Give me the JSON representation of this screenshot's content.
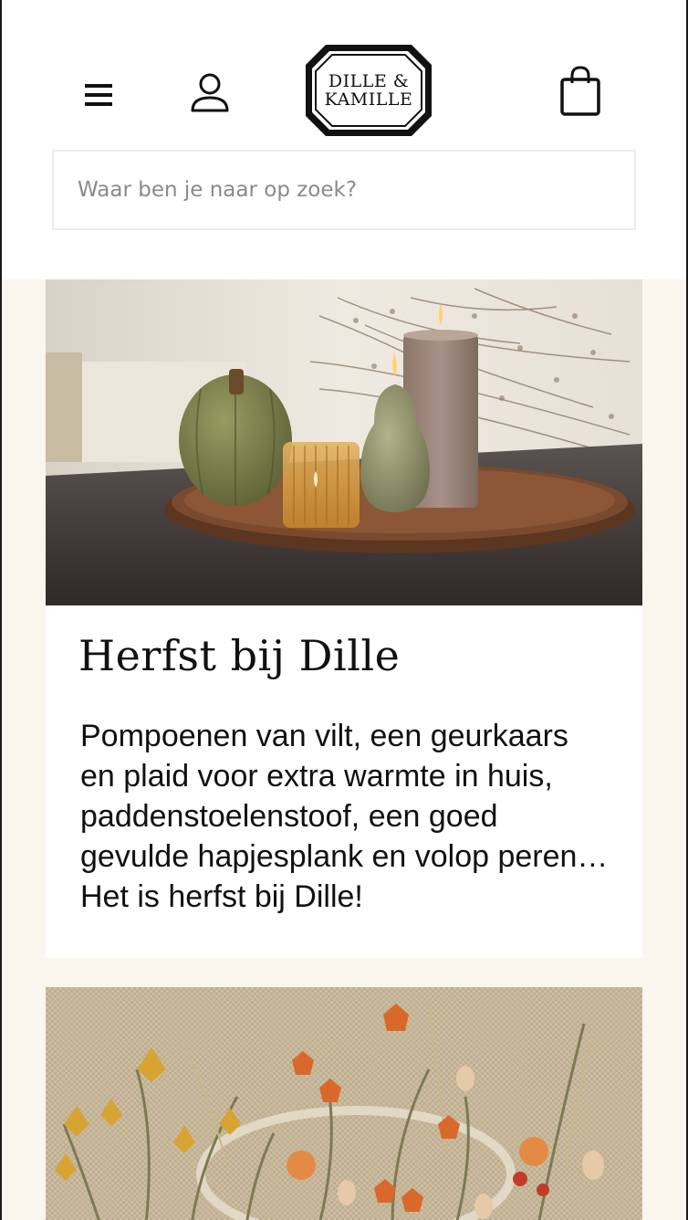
{
  "header": {
    "logo": {
      "line1": "DILLE &",
      "line2": "KAMILLE"
    },
    "search": {
      "placeholder": "Waar ben je naar op zoek?"
    },
    "icons": {
      "menu": "hamburger-icon",
      "account": "user-icon",
      "cart": "shopping-bag-icon"
    }
  },
  "cards": [
    {
      "title": "Herfst bij Dille",
      "text": "Pompoenen van vilt, een geurkaars en plaid voor extra warmte in huis, paddenstoelenstoof, een goed gevulde hapjesplank en volop peren… Het is herfst bij Dille!"
    }
  ],
  "colors": {
    "page_background": "#faf6ee",
    "text": "#111111",
    "search_border": "#ececec"
  }
}
